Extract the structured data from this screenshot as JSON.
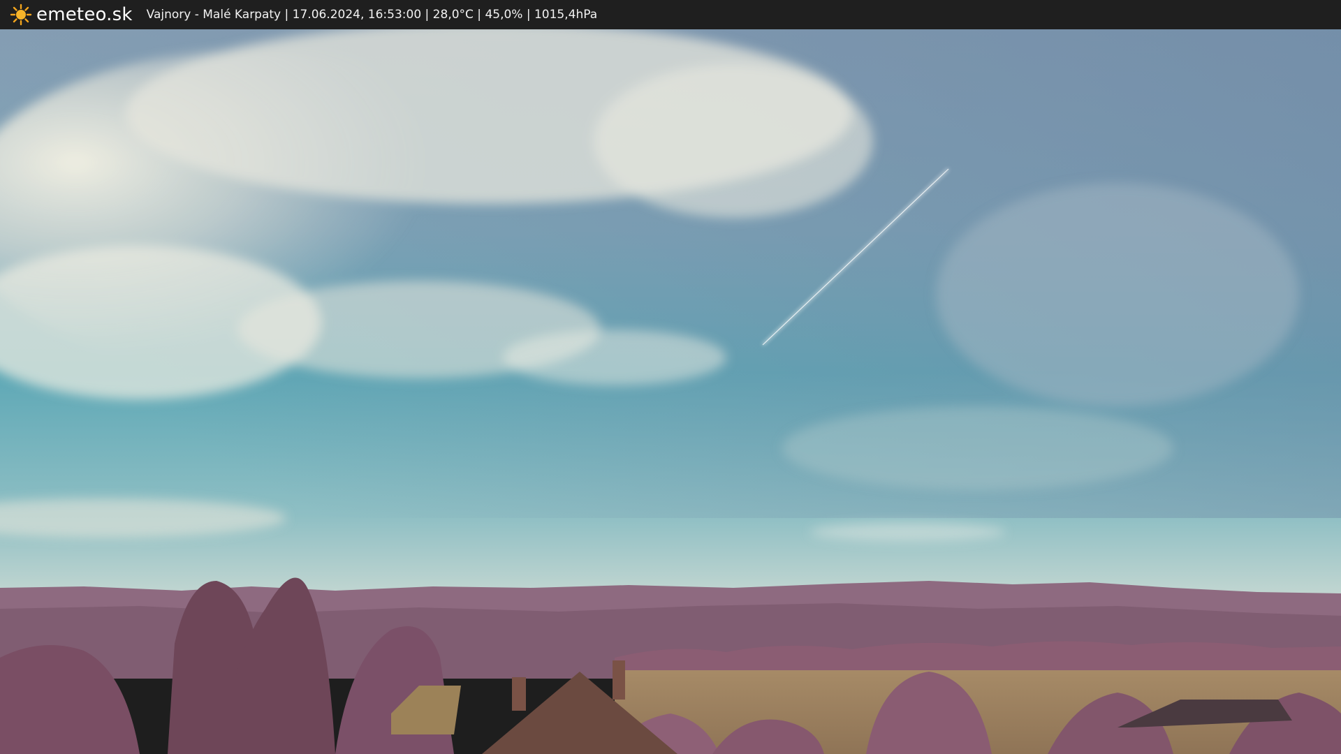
{
  "header": {
    "brand": "emeteo.sk",
    "caption": "Vajnory - Malé Karpaty | 17.06.2024, 16:53:00 | 28,0°C | 45,0% | 1015,4hPa",
    "logo_icon": "sun-icon"
  },
  "colors": {
    "bar_bg": "#1f1f1f",
    "sun": "#f4a51c",
    "sky_top": "#7a97ae",
    "sky_mid": "#5aa3b4",
    "vegetation": "#8a5a6e",
    "field": "#9a8260"
  }
}
